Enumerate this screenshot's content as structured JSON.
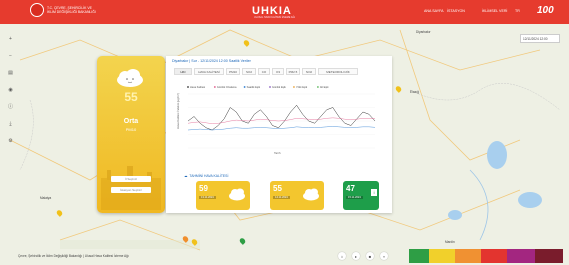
{
  "header": {
    "ministry_line1": "T.C. ÇEVRE, ŞEHİRCİLİK VE",
    "ministry_line2": "İKLİM DEĞİŞİKLİĞİ BAKANLIĞI",
    "brand": "UHKIA",
    "brand_sub": "ULUSAL HAVA KALİTESİ İZLEME AĞI",
    "nav_home": "ANA SAYFA",
    "nav_stations": "İSTASYON",
    "nav_monthly": "İKLİMSEL VERİ",
    "nav_lang": "TR",
    "century": "100"
  },
  "map": {
    "datetime": "12/11/2024 12:00",
    "city_labels": [
      "Diyarbakır",
      "Mardin",
      "Elazığ",
      "Malatya"
    ]
  },
  "card": {
    "aqi": "55",
    "level": "Orta",
    "param": "PM10",
    "input1": "İl Seçiniz",
    "input2": "İstasyon Seçiniz"
  },
  "panel": {
    "header": "Diyarbakır | Sur - 12/11/2024 12:00 Saatlik Veriler",
    "tabs": [
      "HKI",
      "HAVA KALİTESİ",
      "PM10",
      "SO2",
      "CO",
      "O3",
      "PM2.5",
      "NO2",
      "METEOROLOJİK"
    ],
    "active_tab_index": 0,
    "forecast_title": "TAHMİNİ HAVA KALİTESİ",
    "forecasts": [
      {
        "value": "59",
        "date": "13.11.2024"
      },
      {
        "value": "55",
        "date": "14.11.2024"
      },
      {
        "value": "47",
        "date": "15.11.2024",
        "letter": "İ"
      }
    ]
  },
  "chart_data": {
    "type": "line",
    "legend": [
      "Hava Kalitesi",
      "Günlük Ortalama",
      "Saatlik Eşik",
      "Günlük Eşik",
      "Yıllık Eşik",
      "Alt Eşik"
    ],
    "series": [
      {
        "name": "Hava Kalitesi",
        "color": "#333333",
        "values": [
          60,
          70,
          55,
          45,
          40,
          50,
          65,
          90,
          80,
          60,
          55,
          75,
          85,
          70,
          50,
          45,
          60,
          80,
          95,
          75,
          60,
          55,
          70,
          85,
          90,
          70,
          55,
          50,
          65,
          80,
          75,
          60
        ]
      },
      {
        "name": "Günlük Ortalama",
        "color": "#e05a8a",
        "values": [
          55,
          57,
          58,
          56,
          54,
          55,
          57,
          60,
          62,
          61,
          60,
          62,
          64,
          63,
          61,
          60,
          61,
          63,
          66,
          65,
          64,
          63,
          64,
          66,
          67,
          66,
          64,
          63,
          64,
          66,
          66,
          65
        ]
      },
      {
        "name": "Saatlik Eşik",
        "color": "#2a7bd0",
        "values": [
          40,
          41,
          42,
          41,
          40,
          41,
          42,
          44,
          45,
          44,
          44,
          45,
          46,
          45,
          44,
          43,
          44,
          45,
          47,
          46,
          45,
          45,
          46,
          47,
          48,
          47,
          46,
          45,
          46,
          47,
          47,
          46
        ]
      }
    ],
    "ylabel": "Hava Kalitesi İndeksi (µg/m³)",
    "xlabel": "Tarih",
    "ylim": [
      0,
      120
    ]
  },
  "footer": {
    "note": "Çevre, Şehircilik ve İklim Değişikliği Bakanlığı | Ulusal Hava Kalitesi İzleme Ağı",
    "scale_colors": [
      "#2e9e45",
      "#f1d02b",
      "#f09132",
      "#e3342f",
      "#a32680",
      "#7a1c2c"
    ]
  }
}
